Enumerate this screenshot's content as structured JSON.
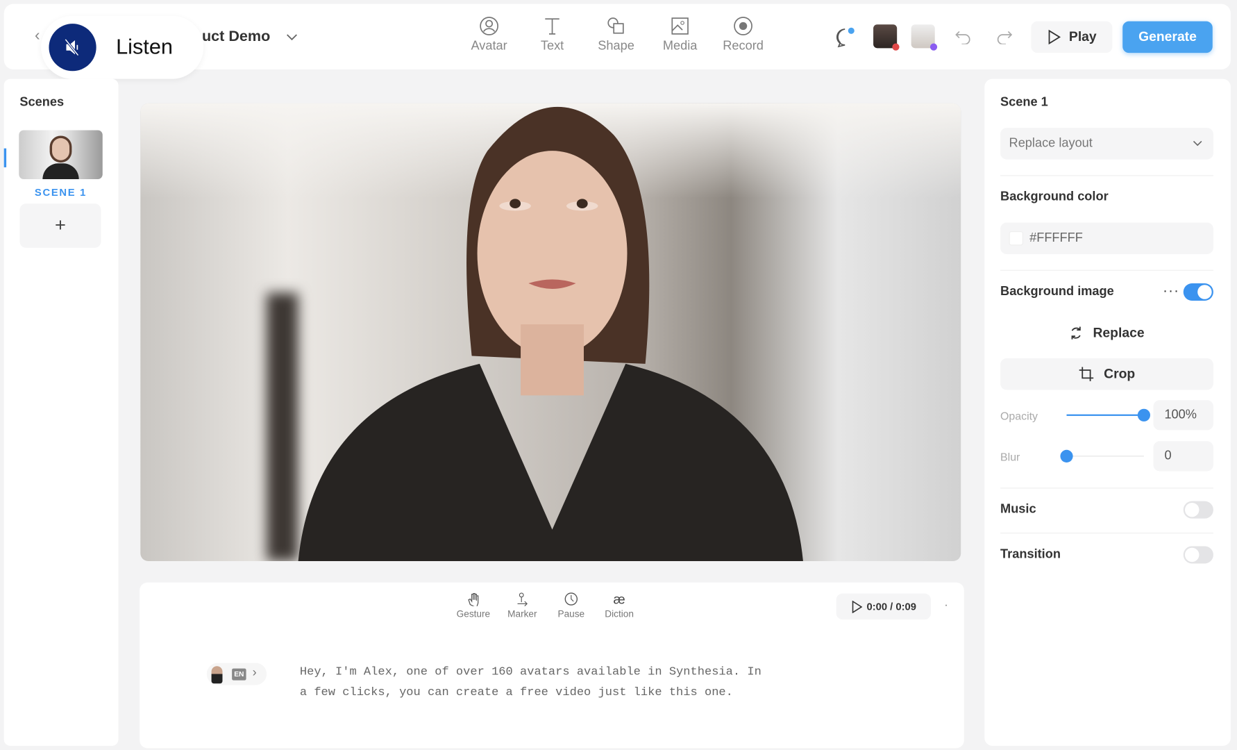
{
  "listen": {
    "label": "Listen",
    "icon": "muted-speaker-icon"
  },
  "header": {
    "project_title": "uct Demo",
    "tools": [
      {
        "label": "Avatar",
        "icon": "avatar-icon"
      },
      {
        "label": "Text",
        "icon": "text-icon"
      },
      {
        "label": "Shape",
        "icon": "shape-icon"
      },
      {
        "label": "Media",
        "icon": "media-icon"
      },
      {
        "label": "Record",
        "icon": "record-icon"
      }
    ],
    "play_label": "Play",
    "generate_label": "Generate"
  },
  "colors": {
    "accent": "#3b93ef",
    "listen_circle": "#0d2a7a"
  },
  "scenes": {
    "title": "Scenes",
    "items": [
      {
        "label": "SCENE 1"
      }
    ],
    "add_label": "+"
  },
  "script": {
    "tools": [
      {
        "label": "Gesture"
      },
      {
        "label": "Marker"
      },
      {
        "label": "Pause"
      },
      {
        "label": "Diction"
      }
    ],
    "time": "0:00 / 0:09",
    "language": "EN",
    "lines": [
      "Hey, I'm Alex, one of over 160 avatars available in Synthesia. In",
      "a few clicks, you can create a free video just like this one."
    ]
  },
  "properties": {
    "title": "Scene 1",
    "layout_placeholder": "Replace layout",
    "bg_color_label": "Background color",
    "bg_color_value": "#FFFFFF",
    "bg_image_label": "Background image",
    "bg_image_enabled": true,
    "replace_label": "Replace",
    "crop_label": "Crop",
    "opacity_label": "Opacity",
    "opacity_value": "100%",
    "opacity": 100,
    "blur_label": "Blur",
    "blur_value": "0",
    "blur": 0,
    "music_label": "Music",
    "music_enabled": false,
    "transition_label": "Transition",
    "transition_enabled": false
  }
}
